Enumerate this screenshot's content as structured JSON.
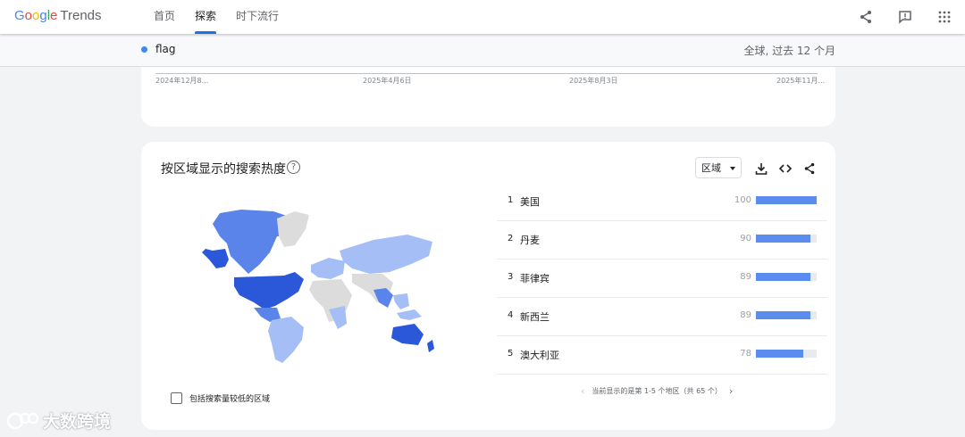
{
  "logo": {
    "g": "G",
    "o1": "o",
    "o2": "o",
    "g2": "g",
    "l": "l",
    "e": "e",
    "trends": "Trends"
  },
  "nav": [
    {
      "label": "首页"
    },
    {
      "label": "探索"
    },
    {
      "label": "时下流行"
    }
  ],
  "top_icons": [
    "share-icon",
    "feedback-icon",
    "apps-icon"
  ],
  "search": {
    "term": "flag",
    "scope": "全球, 过去 12 个月",
    "term_color": "#4285f4"
  },
  "timeline": {
    "ticks": [
      "2024年12月8...",
      "2025年4月6日",
      "2025年8月3日",
      "2025年11月..."
    ]
  },
  "region_card": {
    "title": "按区域显示的搜索热度",
    "help": "?",
    "select_label": "区域",
    "rows": [
      {
        "rank": "1",
        "name": "美国",
        "value": 100
      },
      {
        "rank": "2",
        "name": "丹麦",
        "value": 90
      },
      {
        "rank": "3",
        "name": "菲律宾",
        "value": 89
      },
      {
        "rank": "4",
        "name": "新西兰",
        "value": 89
      },
      {
        "rank": "5",
        "name": "澳大利亚",
        "value": 78
      }
    ],
    "pagination": "当前显示的是第 1-5 个地区（共 65 个）",
    "prev": "‹",
    "next": "›",
    "checkbox_label": "包括搜索量较低的区域"
  },
  "watermark": "大数跨境",
  "colors": {
    "accent": "#1a73e8",
    "bar": "#5b8def",
    "map_dark": "#2b57d9",
    "map_mid": "#5b84ea",
    "map_light": "#a5bff6",
    "map_none": "#dcdcdc"
  }
}
